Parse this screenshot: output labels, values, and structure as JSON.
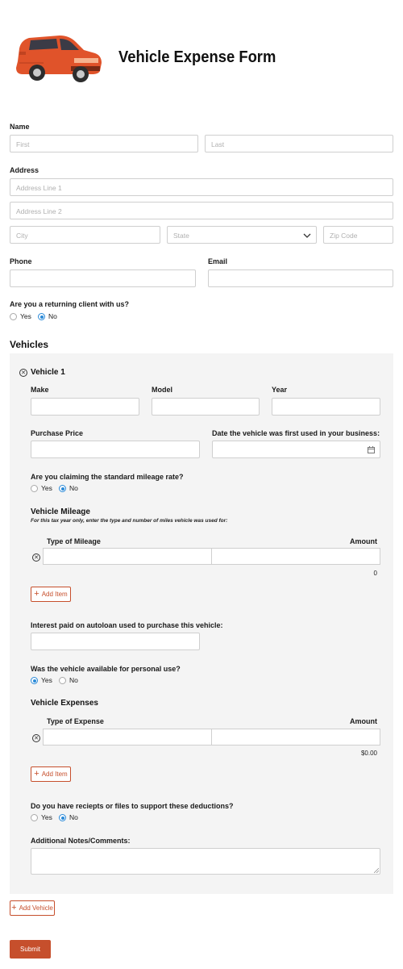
{
  "header": {
    "title": "Vehicle Expense Form"
  },
  "name": {
    "label": "Name",
    "first_placeholder": "First",
    "last_placeholder": "Last"
  },
  "address": {
    "label": "Address",
    "line1_placeholder": "Address Line 1",
    "line2_placeholder": "Address Line 2",
    "city_placeholder": "City",
    "state_placeholder": "State",
    "zip_placeholder": "Zip Code"
  },
  "phone": {
    "label": "Phone"
  },
  "email": {
    "label": "Email"
  },
  "returning": {
    "question": "Are you a returning client with us?",
    "yes": "Yes",
    "no": "No",
    "selected": "No"
  },
  "vehicles": {
    "title": "Vehicles",
    "vehicle_title": "Vehicle 1",
    "make_label": "Make",
    "model_label": "Model",
    "year_label": "Year",
    "price_label": "Purchase Price",
    "date_label": "Date the vehicle was first used in your business:",
    "standard_q": "Are you claiming the standard mileage rate?",
    "standard_yes": "Yes",
    "standard_no": "No",
    "mileage_title": "Vehicle Mileage",
    "mileage_note": "For this tax year only, enter the type and number of miles vehicle was used for:",
    "mileage_col1": "Type of Mileage",
    "mileage_col2": "Amount",
    "mileage_total": "0",
    "add_item": "Add Item",
    "interest_label": "Interest paid on autoloan used to purchase this vehicle:",
    "personal_q": "Was the vehicle available for personal use?",
    "personal_yes": "Yes",
    "personal_no": "No",
    "expenses_title": "Vehicle Expenses",
    "expense_col1": "Type of Expense",
    "expense_col2": "Amount",
    "expense_total": "$0.00",
    "add_item2": "Add Item",
    "receipts_q": "Do you have reciepts or files to support these deductions?",
    "receipts_yes": "Yes",
    "receipts_no": "No",
    "notes_label": "Additional Notes/Comments:"
  },
  "add_vehicle": "Add Vehicle",
  "submit": "Submit",
  "colors": {
    "accent": "#c64f2c",
    "radio": "#2a8ad8",
    "panel": "#f4f4f4"
  },
  "icons": {
    "vehicle_image": "car-icon",
    "remove": "close-circle-icon",
    "calendar": "calendar-icon",
    "dropdown": "chevron-down-icon",
    "add": "plus-icon"
  }
}
